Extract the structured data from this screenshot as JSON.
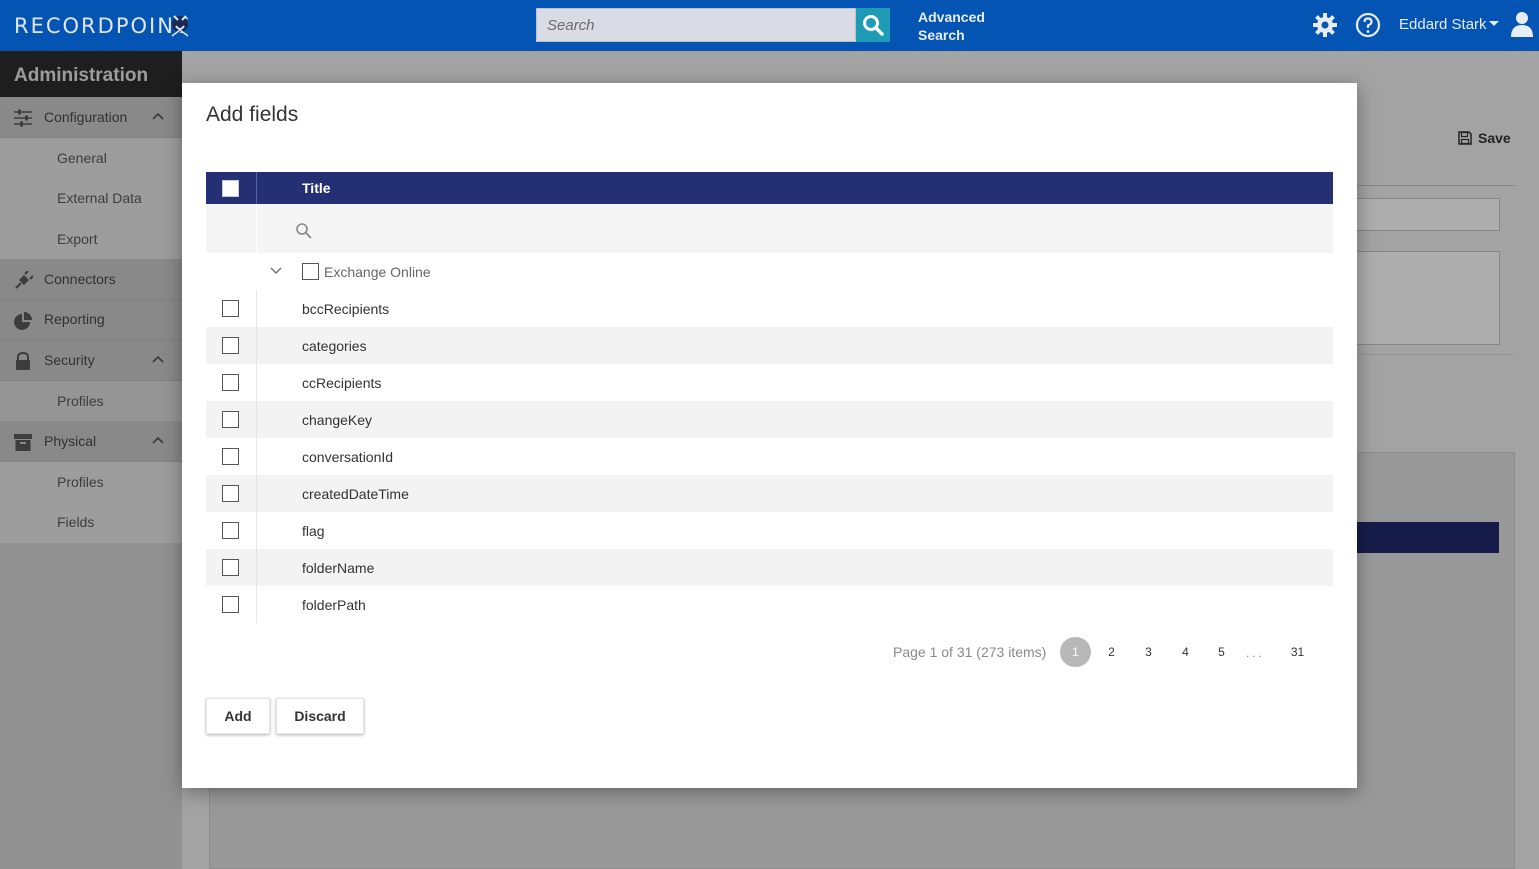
{
  "topbar": {
    "logo": "RECORDPOINT",
    "search_placeholder": "Search",
    "advanced_search_line1": "Advanced",
    "advanced_search_line2": "Search",
    "user_name": "Eddard Stark",
    "icons": [
      "search-icon",
      "gear-icon",
      "help-icon",
      "user-icon"
    ]
  },
  "sidebar": {
    "title": "Administration",
    "sections": [
      {
        "label": "Configuration",
        "icon": "sliders-icon",
        "expanded": true,
        "children": [
          "General",
          "External Data",
          "Export"
        ]
      },
      {
        "label": "Connectors",
        "icon": "plug-icon"
      },
      {
        "label": "Reporting",
        "icon": "pie-chart-icon"
      },
      {
        "label": "Security",
        "icon": "lock-icon",
        "expanded": true,
        "children": [
          "Profiles"
        ]
      },
      {
        "label": "Physical",
        "icon": "archive-box-icon",
        "expanded": true,
        "children": [
          "Profiles",
          "Fields"
        ]
      }
    ]
  },
  "background": {
    "save_label": "Save"
  },
  "modal": {
    "title": "Add fields",
    "column_title": "Title",
    "group_label": "Exchange Online",
    "rows": [
      "bccRecipients",
      "categories",
      "ccRecipients",
      "changeKey",
      "conversationId",
      "createdDateTime",
      "flag",
      "folderName",
      "folderPath"
    ],
    "pager_info": "Page 1 of 31 (273 items)",
    "pages": [
      "1",
      "2",
      "3",
      "4",
      "5"
    ],
    "ellipsis": "...",
    "last_page": "31",
    "current_page": "1",
    "add_label": "Add",
    "discard_label": "Discard"
  },
  "colors": {
    "topbar": "#0454b4",
    "grid_header": "#252f73",
    "search_button": "#1e9bb5"
  }
}
